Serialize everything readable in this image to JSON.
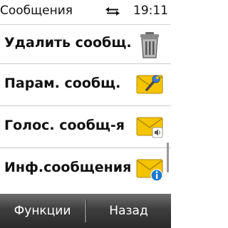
{
  "status_bar": {
    "title": "Сообщения",
    "connectivity_icon": "usb-transfer-arrows-icon",
    "time": "19:11"
  },
  "menu": {
    "items": [
      {
        "label": "Удалить сообщ.",
        "icon": "trash-can-icon"
      },
      {
        "label": "Парам. сообщ.",
        "icon": "envelope-wrench-icon"
      },
      {
        "label": "Голос. сообщ-я",
        "icon": "envelope-speaker-icon"
      },
      {
        "label": "Инф.сообщения",
        "icon": "envelope-info-icon"
      }
    ]
  },
  "softkeys": {
    "left_label": "Функции",
    "right_label": "Назад"
  },
  "colors": {
    "envelope": "#f5c400",
    "info_badge": "#1e78d2",
    "softkey_bar": "#3e3e3e"
  }
}
